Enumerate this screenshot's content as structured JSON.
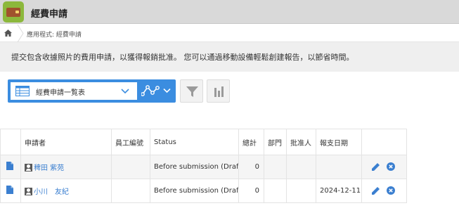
{
  "header": {
    "title": "經費申請",
    "app_icon": "wallet-icon"
  },
  "breadcrumb": {
    "text": "應用程式: 經費申請"
  },
  "description": "提交包含收據照片的費用申請，以獲得報銷批准。 您可以通過移動設備輕鬆創建報告，以節省時間。",
  "view_selector": {
    "label": "經費申請一覧表",
    "accent": "#3b8de0"
  },
  "table": {
    "columns": [
      "",
      "申請者",
      "員工編號",
      "Status",
      "總計",
      "部門",
      "批准人",
      "報支日期",
      ""
    ],
    "rows": [
      {
        "applicant": "稗田 紫苑",
        "employee_id": "",
        "status": "Before submission (Draft)",
        "total": "0",
        "department": "",
        "approver": "",
        "date": ""
      },
      {
        "applicant": "小川　友紀",
        "employee_id": "",
        "status": "Before submission (Draft)",
        "total": "0",
        "department": "",
        "approver": "",
        "date": "2024-12-11"
      }
    ]
  },
  "colors": {
    "link": "#3b7fd0",
    "icon_blue": "#3b7fd0",
    "header_bg": "#d9d9d9"
  }
}
